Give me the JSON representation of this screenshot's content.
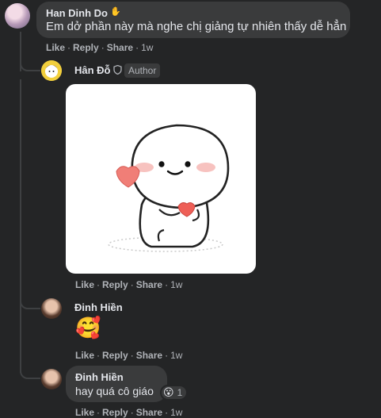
{
  "comments": [
    {
      "author": "Han Dinh Do",
      "text": "Em dở phần này mà nghe chị giảng tự nhiên thấy dễ hẳn",
      "actions": {
        "like": "Like",
        "reply": "Reply",
        "share": "Share",
        "time": "1w"
      }
    },
    {
      "author": "Hân Đỗ",
      "badge": "Author",
      "sticker": "smiling-blob-holding-heart",
      "actions": {
        "like": "Like",
        "reply": "Reply",
        "share": "Share",
        "time": "1w"
      }
    },
    {
      "author": "Đinh Hiền",
      "emoji": "🥰",
      "actions": {
        "like": "Like",
        "reply": "Reply",
        "share": "Share",
        "time": "1w"
      }
    },
    {
      "author": "Đinh Hiền",
      "text": "hay quá cô giáo",
      "reaction": {
        "emoji": "😮",
        "count": "1"
      },
      "actions": {
        "like": "Like",
        "reply": "Reply",
        "share": "Share",
        "time": "1w"
      }
    }
  ],
  "sep": "·"
}
